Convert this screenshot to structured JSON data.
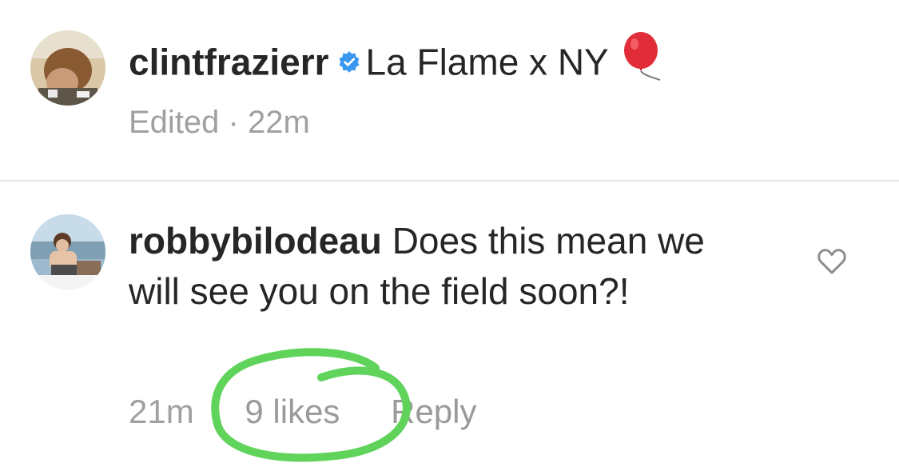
{
  "post": {
    "username": "clintfrazierr",
    "caption": "La Flame x NY",
    "verified_icon": "verified-badge-icon",
    "emoji_icon": "red-balloon-icon",
    "edited": "Edited",
    "separator": "·",
    "time": "22m"
  },
  "comment": {
    "username": "robbybilodeau",
    "text": "Does this mean we will see you on the field soon?!",
    "time": "21m",
    "likes": "9 likes",
    "reply": "Reply",
    "like_icon": "heart-outline-icon"
  },
  "colors": {
    "verified": "#3897f0",
    "annotation": "#5fd35a",
    "meta": "#a0a0a0",
    "text": "#262626"
  }
}
